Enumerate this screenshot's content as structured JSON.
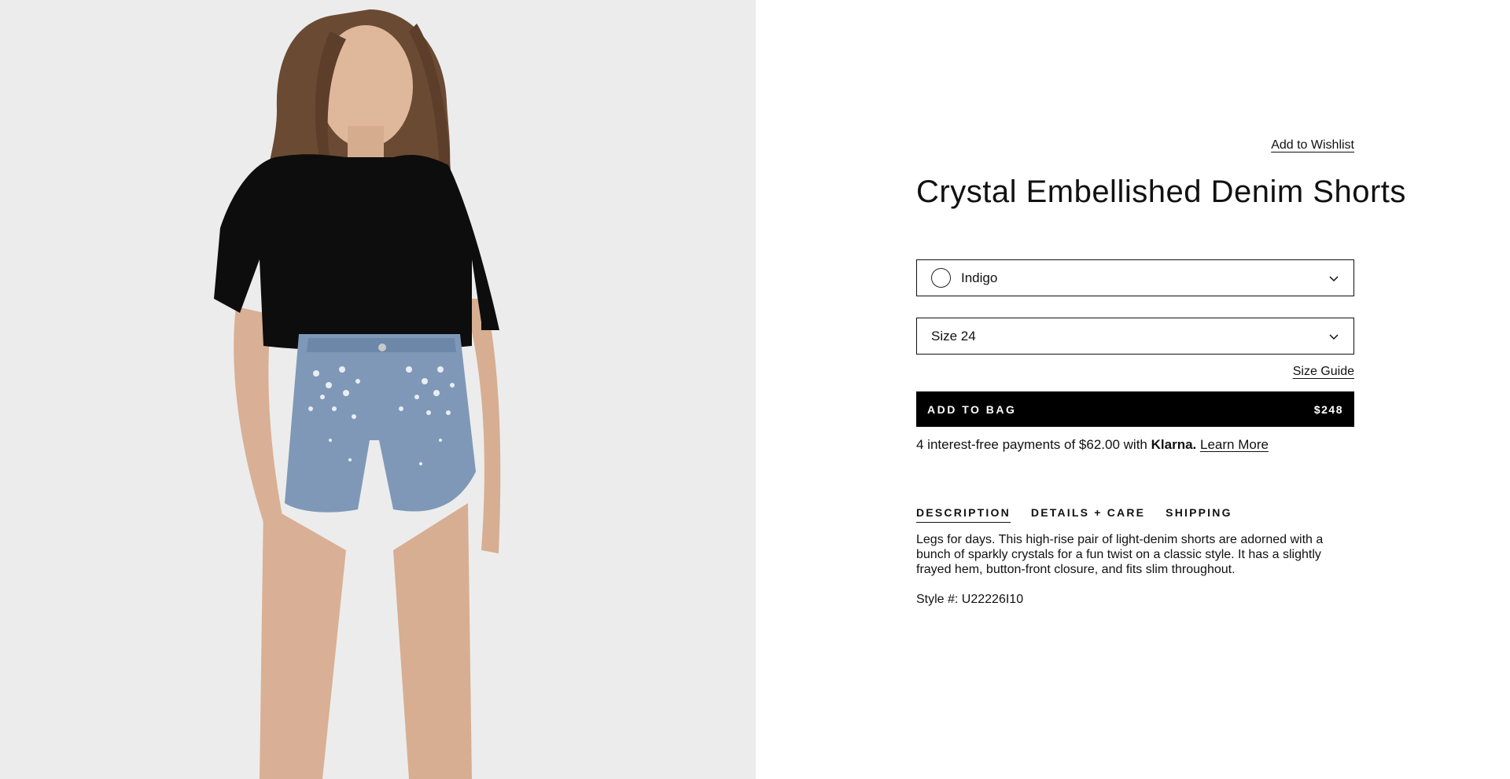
{
  "product": {
    "title": "Crystal Embellished Denim Shorts",
    "wishlist_label": "Add to Wishlist",
    "color": {
      "selected": "Indigo",
      "swatch_color": "#ffffff"
    },
    "size": {
      "selected": "Size 24"
    },
    "size_guide_label": "Size Guide",
    "add_to_bag": {
      "label": "ADD TO BAG",
      "price": "$248"
    },
    "klarna": {
      "text": "4 interest-free payments of $62.00 with",
      "brand": "Klarna.",
      "learn_more": "Learn More"
    },
    "tabs": [
      {
        "label": "DESCRIPTION",
        "active": true
      },
      {
        "label": "DETAILS + CARE",
        "active": false
      },
      {
        "label": "SHIPPING",
        "active": false
      }
    ],
    "description": "Legs for days. This high-rise pair of light-denim shorts are adorned with a bunch of sparkly crystals for a fun twist on a classic style. It has a slightly frayed hem, button-front closure, and fits slim throughout.",
    "style_number": "Style #: U22226I10"
  },
  "icons": {
    "color_chevron": "chevron-down-icon",
    "size_chevron": "chevron-down-icon"
  },
  "colors": {
    "button_bg": "#000000",
    "image_bg": "#ececec",
    "text": "#111111"
  }
}
